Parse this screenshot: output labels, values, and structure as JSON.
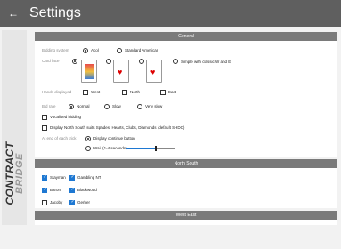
{
  "header": {
    "title": "Settings",
    "back_icon": "back-arrow-icon"
  },
  "brand": {
    "line1": "CONTRACT",
    "line2": "BRIDGE"
  },
  "general": {
    "header": "General",
    "bidding_system": {
      "label": "Bidding system",
      "options": [
        "Acol",
        "Standard American"
      ],
      "selected": "Acol"
    },
    "card_face": {
      "label": "Card face",
      "option_text": "Simple with classic W and E",
      "selected_index": 0
    },
    "hands_displayed": {
      "label": "Hands displayed",
      "options": [
        "West",
        "North",
        "East"
      ]
    },
    "bid_rate": {
      "label": "Bid rate",
      "options": [
        "Normal",
        "Slow",
        "Very slow"
      ],
      "selected": "Normal"
    },
    "vocalised_bidding": "Vocalised bidding",
    "display_suits": "Display North South suits Spades, Hearts, Clubs, Diamonds (default SHDC)",
    "end_of_trick": {
      "label": "At end of each trick",
      "options": [
        "Display continue button",
        "Wait (1-4 seconds)"
      ],
      "selected": "Display continue button",
      "wait_level": 0.6
    }
  },
  "north_south": {
    "header": "North South",
    "conventions": [
      {
        "label": "Stayman",
        "checked": true
      },
      {
        "label": "Gambling NT",
        "checked": true
      },
      {
        "label": "Baron",
        "checked": true
      },
      {
        "label": "Blackwood",
        "checked": true
      },
      {
        "label": "Jacoby",
        "checked": false
      },
      {
        "label": "Gerber",
        "checked": true
      }
    ]
  },
  "west_east": {
    "header": "West East"
  },
  "colors": {
    "titlebar": "#5f5f5f",
    "section_header": "#7a7a7a",
    "checkbox": "#1e78d2"
  }
}
